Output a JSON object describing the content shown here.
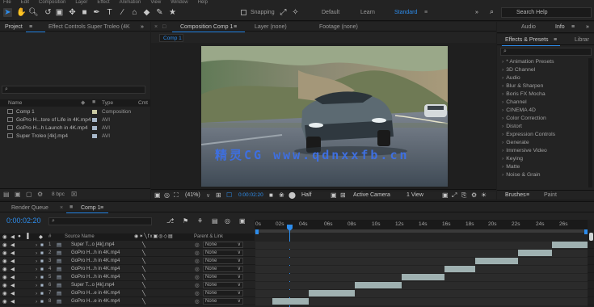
{
  "menu": [
    "File",
    "Edit",
    "Composition",
    "Layer",
    "Effect",
    "Animation",
    "View",
    "Window",
    "Help"
  ],
  "toolbar": {
    "snapping_label": "Snapping",
    "workspaces": [
      "Default",
      "Learn",
      "Standard"
    ],
    "search_placeholder": "Search Help"
  },
  "project_panel": {
    "tab_project": "Project",
    "tab_effect_controls": "Effect Controls Super Troleo (4K",
    "search_placeholder": "",
    "columns": {
      "name": "Name",
      "type": "Type",
      "comment": "Cmt"
    },
    "items": [
      {
        "name": "Comp 1",
        "type": "Composition",
        "color": "#c9c9a3"
      },
      {
        "name": "GoPro H...tore of Life in 4K.mp4",
        "type": "AVI",
        "color": "#a7b7c9"
      },
      {
        "name": "GoPro H...h Launch in 4K.mp4",
        "type": "AVI",
        "color": "#a7b7c9"
      },
      {
        "name": "Super Troleo [4k].mp4",
        "type": "AVI",
        "color": "#a7b7c9"
      }
    ],
    "footer_bpc": "8 bpc"
  },
  "viewer": {
    "tab_composition": "Composition Comp 1",
    "tab_layer": "Layer (none)",
    "tab_footage": "Footage (none)",
    "comp_tab": "Comp 1",
    "watermark": "精灵CG www.qdnxxfb.cn",
    "zoom": "(41%)",
    "timecode": "0:00:02:20",
    "resolution": "Half",
    "camera": "Active Camera",
    "view": "1 View"
  },
  "effects_panel": {
    "tab_audio": "Audio",
    "tab_info": "Info",
    "tab_effects": "Effects & Presets",
    "tab_libraries": "Librar",
    "search_placeholder": "",
    "items": [
      "* Animation Presets",
      "3D Channel",
      "Audio",
      "Blur & Sharpen",
      "Boris FX Mocha",
      "Channel",
      "CINEMA 4D",
      "Color Correction",
      "Distort",
      "Expression Controls",
      "Generate",
      "Immersive Video",
      "Keying",
      "Matte",
      "Noise & Grain"
    ]
  },
  "brushes_panel": {
    "tab_brushes": "Brushes",
    "tab_paint": "Paint"
  },
  "timeline": {
    "tab_render_queue": "Render Queue",
    "tab_comp": "Comp 1",
    "timecode": "0:00:02:20",
    "search_placeholder": "",
    "col_source_name": "Source Name",
    "col_parent": "Parent & Link",
    "ruler": [
      "0s",
      "02s",
      "04s",
      "06s",
      "08s",
      "10s",
      "12s",
      "14s",
      "16s",
      "18s",
      "20s",
      "22s",
      "24s",
      "26s"
    ],
    "layers": [
      {
        "num": "1",
        "name": "Super T...o [4k].mp4",
        "parent": "None",
        "bar_start": 0.894,
        "bar_end": 1.0
      },
      {
        "num": "2",
        "name": "GoPro H...h in 4K.mp4",
        "parent": "None",
        "bar_start": 0.79,
        "bar_end": 0.894
      },
      {
        "num": "3",
        "name": "GoPro H...h in 4K.mp4",
        "parent": "None",
        "bar_start": 0.661,
        "bar_end": 0.79
      },
      {
        "num": "4",
        "name": "GoPro H...h in 4K.mp4",
        "parent": "None",
        "bar_start": 0.57,
        "bar_end": 0.661
      },
      {
        "num": "5",
        "name": "GoPro H...h in 4K.mp4",
        "parent": "None",
        "bar_start": 0.44,
        "bar_end": 0.57
      },
      {
        "num": "6",
        "name": "Super T...o [4k].mp4",
        "parent": "None",
        "bar_start": 0.3,
        "bar_end": 0.44
      },
      {
        "num": "7",
        "name": "GoPro H...e in 4K.mp4",
        "parent": "None",
        "bar_start": 0.16,
        "bar_end": 0.3
      },
      {
        "num": "8",
        "name": "GoPro H...e in 4K.mp4",
        "parent": "None",
        "bar_start": 0.05,
        "bar_end": 0.16
      }
    ]
  },
  "colors": {
    "accent": "#2d8ceb",
    "bar": "#9fb1b1",
    "panel": "#232323",
    "background": "#1d1d1d"
  }
}
